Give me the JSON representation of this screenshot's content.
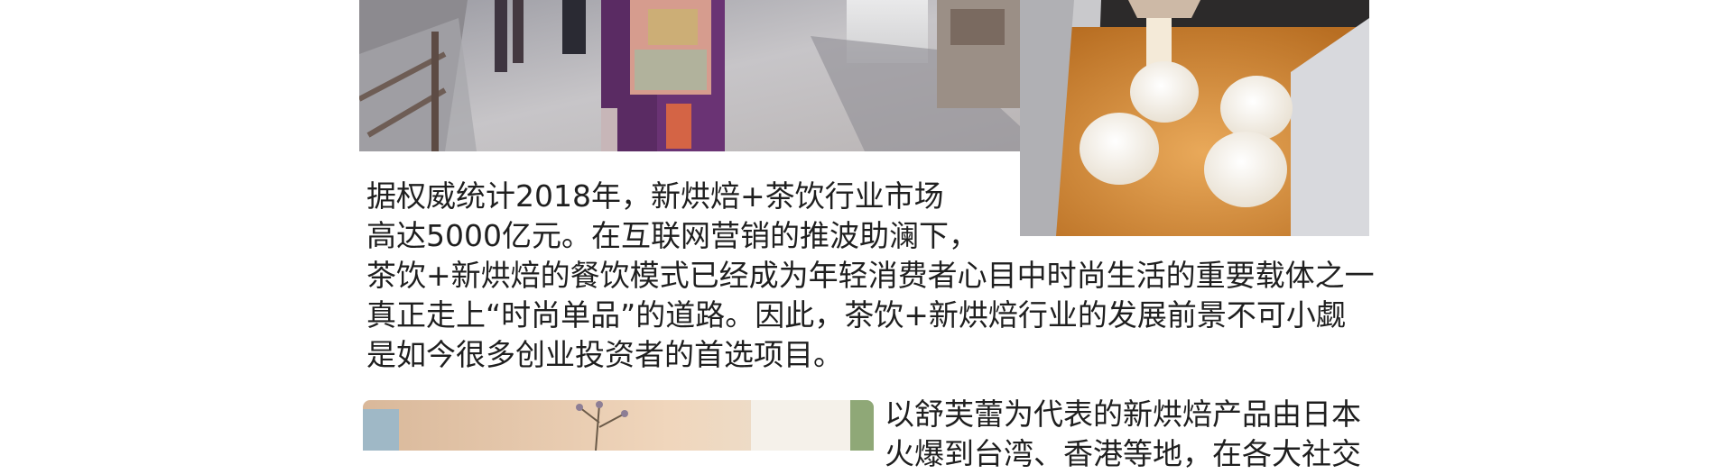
{
  "article": {
    "paragraph1": {
      "lines": [
        "据权威统计2018年，新烘焙+茶饮行业市场",
        "高达5000亿元。在互联网营销的推波助澜下，",
        "茶饮+新烘焙的餐饮模式已经成为年轻消费者心目中时尚生活的重要载体之一",
        "真正走上“时尚单品”的道路。因此，茶饮+新烘焙行业的发展前景不可小觑",
        "是如今很多创业投资者的首选项目。"
      ]
    },
    "paragraph2": {
      "lines": [
        "以舒芙蕾为代表的新烘焙产品由日本",
        "火爆到台湾、香港等地，在各大社交"
      ]
    }
  },
  "images": {
    "street_photo": {
      "alt": "kimono-street-photo"
    },
    "bakery_photo": {
      "alt": "cream-buns-photo"
    },
    "flower_photo": {
      "alt": "dried-flower-photo"
    }
  },
  "colors": {
    "text": "#1f1f1f",
    "background": "#ffffff"
  }
}
